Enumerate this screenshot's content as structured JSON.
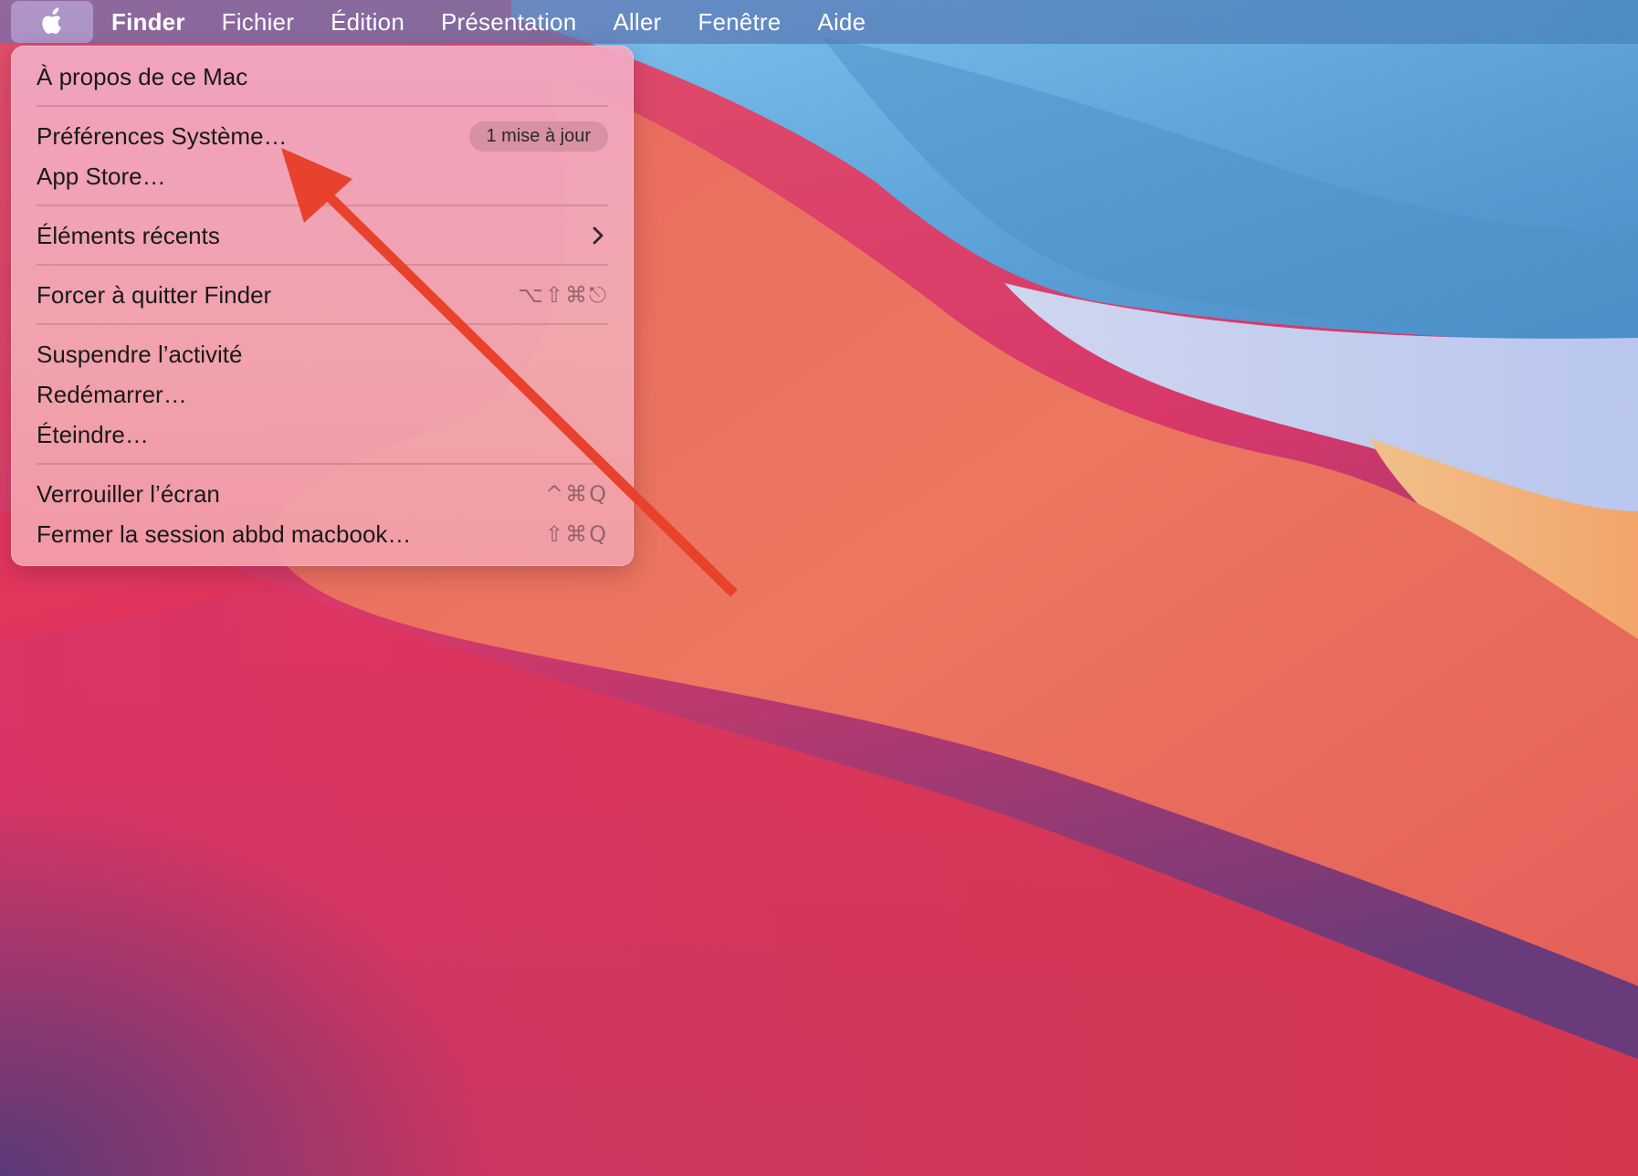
{
  "menubar": {
    "apple_icon": "apple-logo-icon",
    "items": [
      {
        "label": "Finder"
      },
      {
        "label": "Fichier"
      },
      {
        "label": "Édition"
      },
      {
        "label": "Présentation"
      },
      {
        "label": "Aller"
      },
      {
        "label": "Fenêtre"
      },
      {
        "label": "Aide"
      }
    ]
  },
  "apple_menu": {
    "items": [
      {
        "label": "À propos de ce Mac"
      },
      {
        "label": "Préférences Système…",
        "badge": "1 mise à jour"
      },
      {
        "label": "App Store…"
      },
      {
        "label": "Éléments récents",
        "submenu_icon": "chevron-right-icon"
      },
      {
        "label": "Forcer à quitter Finder",
        "shortcut": "⌥⇧⌘⎋"
      },
      {
        "label": "Suspendre l’activité"
      },
      {
        "label": "Redémarrer…"
      },
      {
        "label": "Éteindre…"
      },
      {
        "label": "Verrouiller l’écran",
        "shortcut": "^⌘Q"
      },
      {
        "label": "Fermer la session abbd macbook…",
        "shortcut": "⇧⌘Q"
      }
    ]
  },
  "colors": {
    "annotation_arrow": "#E8412C",
    "menu_background": "#F2A8C0",
    "wallpaper_red": "#E5404F",
    "wallpaper_blue": "#5FA3DA"
  }
}
